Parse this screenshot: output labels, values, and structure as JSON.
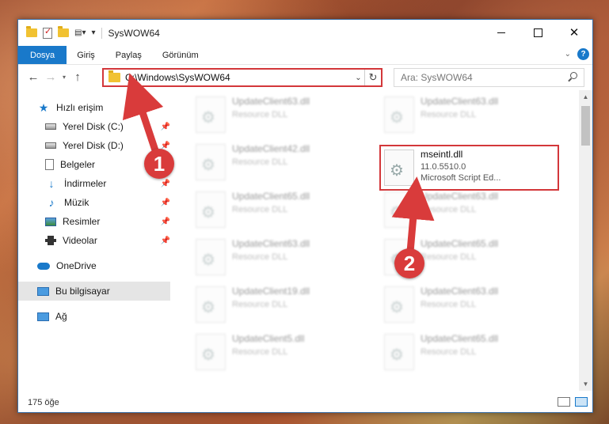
{
  "window": {
    "title": "SysWOW64",
    "controls": {
      "minimize": "",
      "maximize": "",
      "close": "✕"
    }
  },
  "ribbon": {
    "tabs": [
      "Dosya",
      "Giriş",
      "Paylaş",
      "Görünüm"
    ],
    "help": "?"
  },
  "addressbar": {
    "path": "C:\\Windows\\SysWOW64",
    "search_placeholder": "Ara: SysWOW64"
  },
  "nav": {
    "quick_access": "Hızlı erişim",
    "items": [
      {
        "label": "Yerel Disk (C:)",
        "icon": "disk-icon",
        "pinned": true
      },
      {
        "label": "Yerel Disk (D:)",
        "icon": "disk-icon",
        "pinned": true
      },
      {
        "label": "Belgeler",
        "icon": "document-icon",
        "pinned": true
      },
      {
        "label": "İndirmeler",
        "icon": "download-icon",
        "pinned": true
      },
      {
        "label": "Müzik",
        "icon": "music-icon",
        "pinned": true
      },
      {
        "label": "Resimler",
        "icon": "pictures-icon",
        "pinned": true
      },
      {
        "label": "Videolar",
        "icon": "videos-icon",
        "pinned": true
      }
    ],
    "onedrive": "OneDrive",
    "this_pc": "Bu bilgisayar",
    "network": "Ağ"
  },
  "files": {
    "left": [
      {
        "name": "UpdateClient63.dll",
        "desc": "Resource DLL"
      },
      {
        "name": "UpdateClient42.dll",
        "desc": "Resource DLL"
      },
      {
        "name": "UpdateClient65.dll",
        "desc": "Resource DLL"
      },
      {
        "name": "UpdateClient63.dll",
        "desc": "Resource DLL"
      },
      {
        "name": "UpdateClient19.dll",
        "desc": "Resource DLL"
      },
      {
        "name": "UpdateClient5.dll",
        "desc": "Resource DLL"
      }
    ],
    "right": [
      {
        "name": "UpdateClient63.dll",
        "desc": "Resource DLL"
      },
      {
        "name": "mseintl.dll",
        "version": "11.0.5510.0",
        "desc": "Microsoft Script Ed...",
        "highlighted": true
      },
      {
        "name": "UpdateClient63.dll",
        "desc": "Resource DLL"
      },
      {
        "name": "UpdateClient65.dll",
        "desc": "Resource DLL"
      },
      {
        "name": "UpdateClient63.dll",
        "desc": "Resource DLL"
      },
      {
        "name": "UpdateClient65.dll",
        "desc": "Resource DLL"
      }
    ]
  },
  "status": {
    "item_count": "175 öğe"
  },
  "callouts": {
    "step1": "1",
    "step2": "2"
  },
  "colors": {
    "accent": "#1979ca",
    "highlight": "#d3373a",
    "callout": "#d93b3b"
  }
}
